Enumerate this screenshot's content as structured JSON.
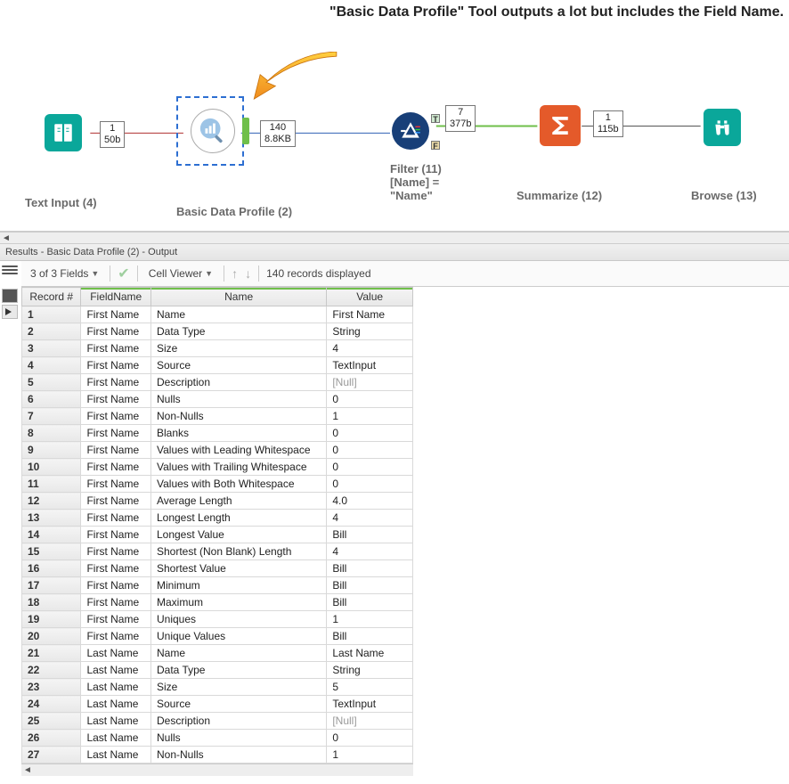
{
  "callout": "\"Basic Data Profile\" Tool outputs a lot but includes the Field Name.",
  "tools": {
    "textInput": {
      "label": "Text Input (4)",
      "badge1": "1",
      "badge2": "50b"
    },
    "basicProfile": {
      "label": "Basic Data Profile (2)",
      "badge1": "140",
      "badge2": "8.8KB"
    },
    "filter": {
      "label": "Filter (11)",
      "sub1": "[Name] =",
      "sub2": "\"Name\"",
      "badge1": "7",
      "badge2": "377b"
    },
    "summarize": {
      "label": "Summarize (12)",
      "badge1": "1",
      "badge2": "115b"
    },
    "browse": {
      "label": "Browse (13)"
    }
  },
  "resultsTitle": "Results - Basic Data Profile (2) - Output",
  "toolbar": {
    "fields": "3 of 3 Fields",
    "cellViewer": "Cell Viewer",
    "records": "140 records displayed"
  },
  "columns": [
    "Record #",
    "FieldName",
    "Name",
    "Value"
  ],
  "rows": [
    {
      "n": "1",
      "f": "First Name",
      "name": "Name",
      "v": "First Name"
    },
    {
      "n": "2",
      "f": "First Name",
      "name": "Data Type",
      "v": "String"
    },
    {
      "n": "3",
      "f": "First Name",
      "name": "Size",
      "v": "4"
    },
    {
      "n": "4",
      "f": "First Name",
      "name": "Source",
      "v": "TextInput"
    },
    {
      "n": "5",
      "f": "First Name",
      "name": "Description",
      "v": "[Null]",
      "null": true
    },
    {
      "n": "6",
      "f": "First Name",
      "name": "Nulls",
      "v": "0"
    },
    {
      "n": "7",
      "f": "First Name",
      "name": "Non-Nulls",
      "v": "1"
    },
    {
      "n": "8",
      "f": "First Name",
      "name": "Blanks",
      "v": "0"
    },
    {
      "n": "9",
      "f": "First Name",
      "name": "Values with Leading Whitespace",
      "v": "0"
    },
    {
      "n": "10",
      "f": "First Name",
      "name": "Values with Trailing Whitespace",
      "v": "0"
    },
    {
      "n": "11",
      "f": "First Name",
      "name": "Values with Both Whitespace",
      "v": "0"
    },
    {
      "n": "12",
      "f": "First Name",
      "name": "Average Length",
      "v": "4.0"
    },
    {
      "n": "13",
      "f": "First Name",
      "name": "Longest Length",
      "v": "4"
    },
    {
      "n": "14",
      "f": "First Name",
      "name": "Longest Value",
      "v": "Bill"
    },
    {
      "n": "15",
      "f": "First Name",
      "name": "Shortest (Non Blank) Length",
      "v": "4"
    },
    {
      "n": "16",
      "f": "First Name",
      "name": "Shortest Value",
      "v": "Bill"
    },
    {
      "n": "17",
      "f": "First Name",
      "name": "Minimum",
      "v": "Bill"
    },
    {
      "n": "18",
      "f": "First Name",
      "name": "Maximum",
      "v": "Bill"
    },
    {
      "n": "19",
      "f": "First Name",
      "name": "Uniques",
      "v": "1"
    },
    {
      "n": "20",
      "f": "First Name",
      "name": "Unique Values",
      "v": "Bill"
    },
    {
      "n": "21",
      "f": "Last Name",
      "name": "Name",
      "v": "Last Name"
    },
    {
      "n": "22",
      "f": "Last Name",
      "name": "Data Type",
      "v": "String"
    },
    {
      "n": "23",
      "f": "Last Name",
      "name": "Size",
      "v": "5"
    },
    {
      "n": "24",
      "f": "Last Name",
      "name": "Source",
      "v": "TextInput"
    },
    {
      "n": "25",
      "f": "Last Name",
      "name": "Description",
      "v": "[Null]",
      "null": true
    },
    {
      "n": "26",
      "f": "Last Name",
      "name": "Nulls",
      "v": "0"
    },
    {
      "n": "27",
      "f": "Last Name",
      "name": "Non-Nulls",
      "v": "1"
    }
  ]
}
